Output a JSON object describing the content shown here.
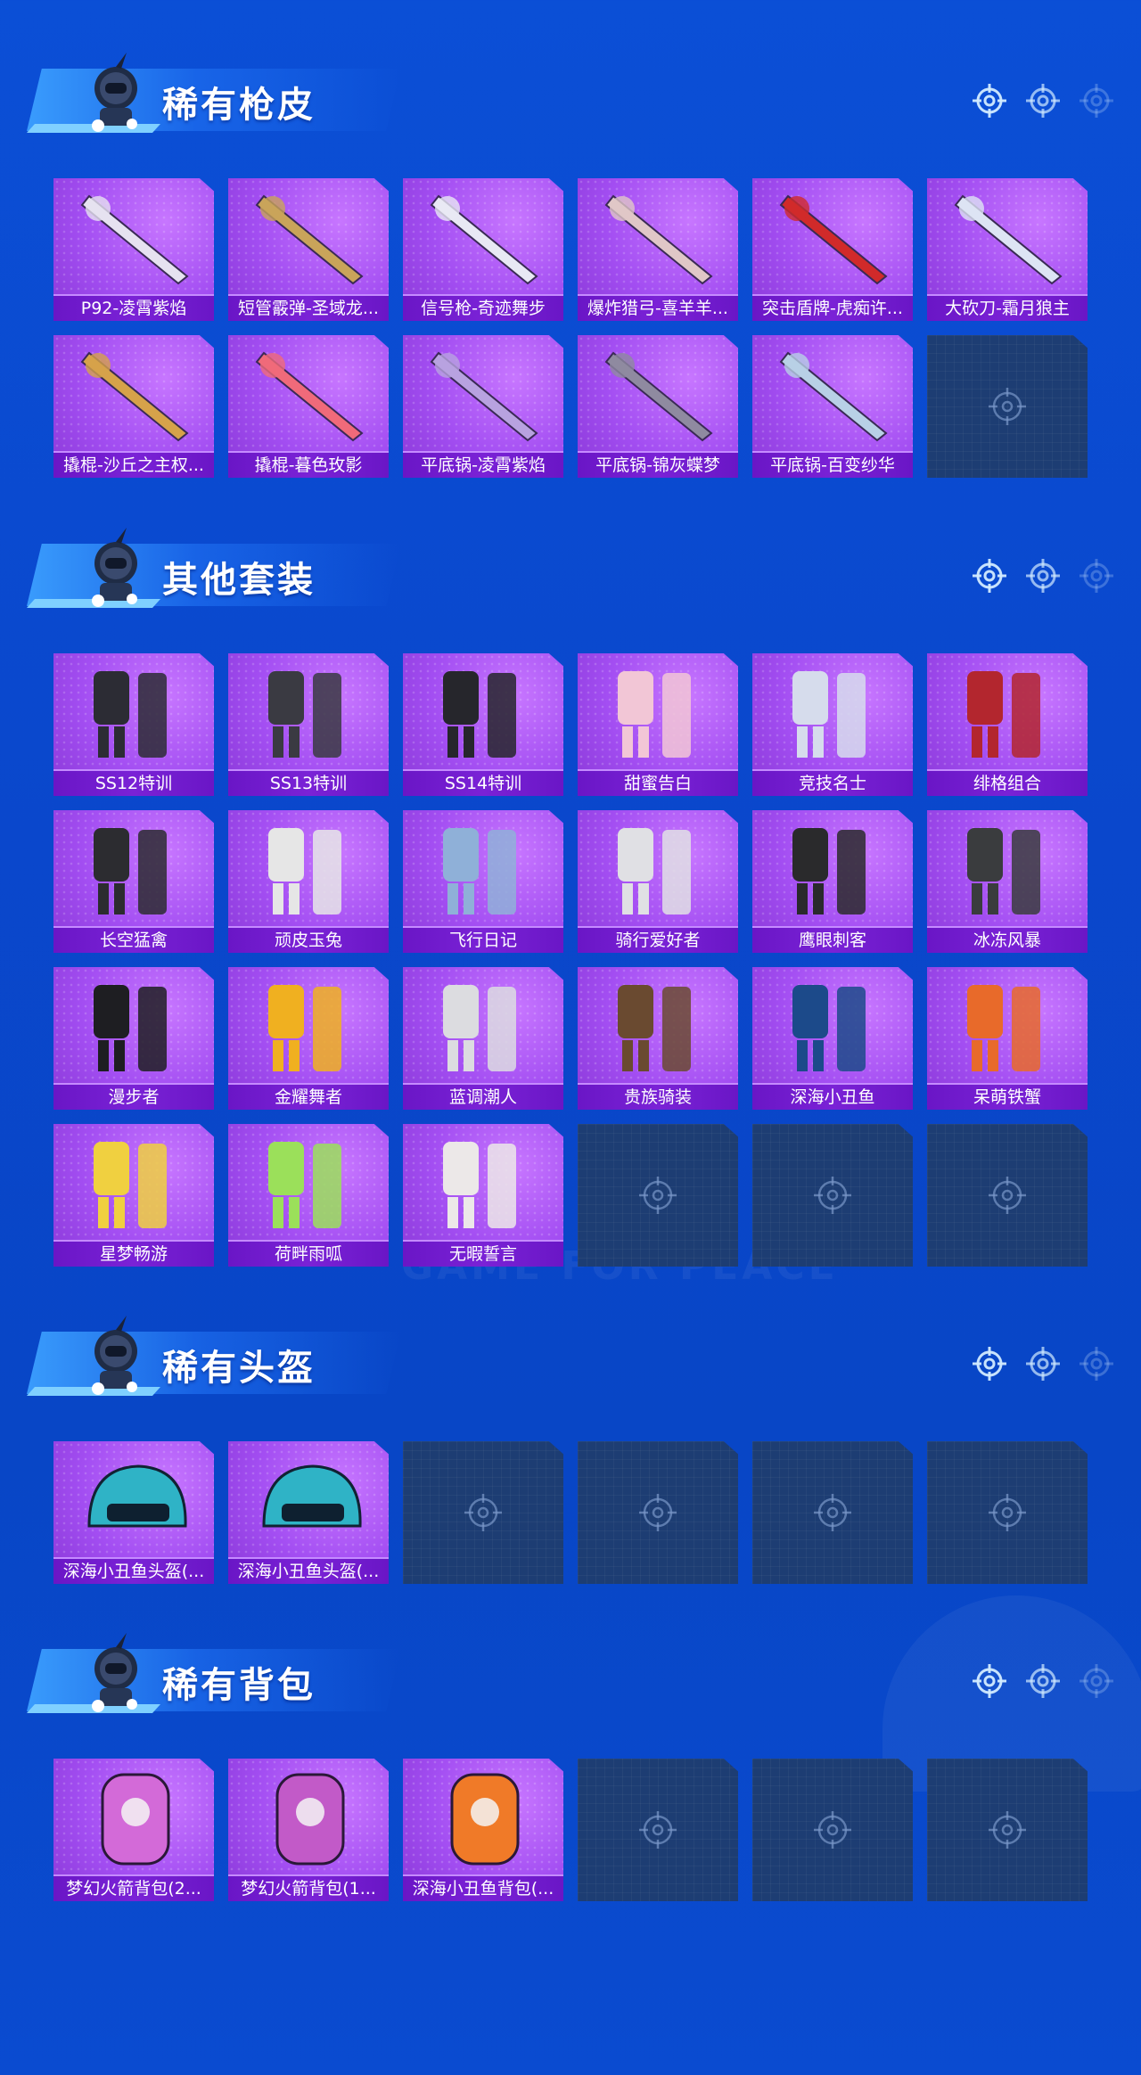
{
  "watermark": "GAME FOR PEACE",
  "colors": {
    "background": "#0b4fd6",
    "card_purple": "#a34ef2",
    "label_bar": "#6a16c6",
    "empty_slot": "#1d3d73"
  },
  "sections": [
    {
      "title": "稀有枪皮",
      "items": [
        "P92-凌霄紫焰",
        "短管霰弹-圣域龙...",
        "信号枪-奇迹舞步",
        "爆炸猎弓-喜羊羊...",
        "突击盾牌-虎痴许...",
        "大砍刀-霜月狼主",
        "撬棍-沙丘之主权...",
        "撬棍-暮色玫影",
        "平底锅-凌霄紫焰",
        "平底锅-锦灰蝶梦",
        "平底锅-百变纱华"
      ]
    },
    {
      "title": "其他套装",
      "items": [
        "SS12特训",
        "SS13特训",
        "SS14特训",
        "甜蜜告白",
        "竞技名士",
        "绯格组合",
        "长空猛禽",
        "顽皮玉兔",
        "飞行日记",
        "骑行爱好者",
        "鹰眼刺客",
        "冰冻风暴",
        "漫步者",
        "金耀舞者",
        "蓝调潮人",
        "贵族骑装",
        "深海小丑鱼",
        "呆萌铁蟹",
        "星梦畅游",
        "荷畔雨呱",
        "无暇誓言"
      ]
    },
    {
      "title": "稀有头盔",
      "items": [
        "深海小丑鱼头盔(...",
        "深海小丑鱼头盔(..."
      ]
    },
    {
      "title": "稀有背包",
      "items": [
        "梦幻火箭背包(2...",
        "梦幻火箭背包(1...",
        "深海小丑鱼背包(..."
      ]
    }
  ]
}
